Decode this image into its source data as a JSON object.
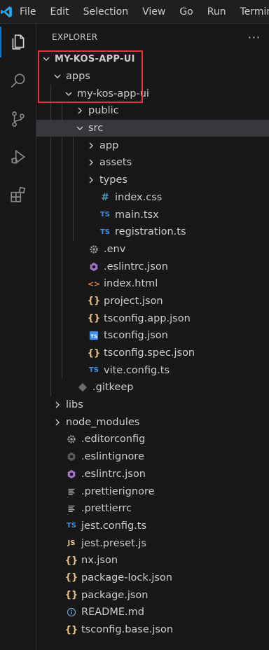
{
  "menu": [
    "File",
    "Edit",
    "Selection",
    "View",
    "Go",
    "Run",
    "Termina"
  ],
  "sidebar": {
    "title": "EXPLORER",
    "more": "···"
  },
  "tree": [
    {
      "label": "MY-KOS-APP-UI",
      "depth": 0,
      "kind": "folder",
      "open": true,
      "root": true
    },
    {
      "label": "apps",
      "depth": 1,
      "kind": "folder",
      "open": true
    },
    {
      "label": "my-kos-app-ui",
      "depth": 2,
      "kind": "folder",
      "open": true
    },
    {
      "label": "public",
      "depth": 3,
      "kind": "folder",
      "open": false
    },
    {
      "label": "src",
      "depth": 3,
      "kind": "folder",
      "open": true,
      "selected": true
    },
    {
      "label": "app",
      "depth": 4,
      "kind": "folder",
      "open": false
    },
    {
      "label": "assets",
      "depth": 4,
      "kind": "folder",
      "open": false
    },
    {
      "label": "types",
      "depth": 4,
      "kind": "folder",
      "open": false
    },
    {
      "label": "index.css",
      "depth": 4,
      "kind": "file",
      "icon": "hash-icon"
    },
    {
      "label": "main.tsx",
      "depth": 4,
      "kind": "file",
      "icon": "ts-icon"
    },
    {
      "label": "registration.ts",
      "depth": 4,
      "kind": "file",
      "icon": "ts-icon"
    },
    {
      "label": ".env",
      "depth": 3,
      "kind": "file",
      "icon": "gear-icon"
    },
    {
      "label": ".eslintrc.json",
      "depth": 3,
      "kind": "file",
      "icon": "eslint-icon"
    },
    {
      "label": "index.html",
      "depth": 3,
      "kind": "file",
      "icon": "html-icon"
    },
    {
      "label": "project.json",
      "depth": 3,
      "kind": "file",
      "icon": "json-icon"
    },
    {
      "label": "tsconfig.app.json",
      "depth": 3,
      "kind": "file",
      "icon": "json-icon"
    },
    {
      "label": "tsconfig.json",
      "depth": 3,
      "kind": "file",
      "icon": "tsconfig-icon"
    },
    {
      "label": "tsconfig.spec.json",
      "depth": 3,
      "kind": "file",
      "icon": "json-icon"
    },
    {
      "label": "vite.config.ts",
      "depth": 3,
      "kind": "file",
      "icon": "ts-icon"
    },
    {
      "label": ".gitkeep",
      "depth": 2,
      "kind": "file",
      "icon": "git-icon"
    },
    {
      "label": "libs",
      "depth": 1,
      "kind": "folder",
      "open": false
    },
    {
      "label": "node_modules",
      "depth": 1,
      "kind": "folder",
      "open": false
    },
    {
      "label": ".editorconfig",
      "depth": 1,
      "kind": "file",
      "icon": "gear-icon"
    },
    {
      "label": ".eslintignore",
      "depth": 1,
      "kind": "file",
      "icon": "eslintignore-icon"
    },
    {
      "label": ".eslintrc.json",
      "depth": 1,
      "kind": "file",
      "icon": "eslint-icon"
    },
    {
      "label": ".prettierignore",
      "depth": 1,
      "kind": "file",
      "icon": "lines-icon"
    },
    {
      "label": ".prettierrc",
      "depth": 1,
      "kind": "file",
      "icon": "lines-icon"
    },
    {
      "label": "jest.config.ts",
      "depth": 1,
      "kind": "file",
      "icon": "ts-icon"
    },
    {
      "label": "jest.preset.js",
      "depth": 1,
      "kind": "file",
      "icon": "js-icon"
    },
    {
      "label": "nx.json",
      "depth": 1,
      "kind": "file",
      "icon": "json-icon"
    },
    {
      "label": "package-lock.json",
      "depth": 1,
      "kind": "file",
      "icon": "json-icon"
    },
    {
      "label": "package.json",
      "depth": 1,
      "kind": "file",
      "icon": "json-icon"
    },
    {
      "label": "README.md",
      "depth": 1,
      "kind": "file",
      "icon": "info-icon"
    },
    {
      "label": "tsconfig.base.json",
      "depth": 1,
      "kind": "file",
      "icon": "json-icon"
    }
  ],
  "colors": {
    "accent": "#0078d4",
    "highlight": "#e8353d",
    "selected_row": "#37373d"
  }
}
